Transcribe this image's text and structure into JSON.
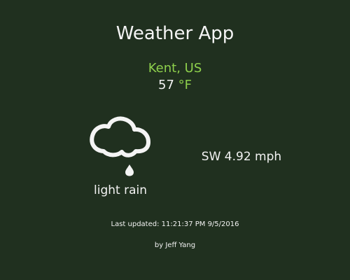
{
  "app": {
    "title": "Weather App"
  },
  "location": {
    "name": "Kent, US"
  },
  "temperature": {
    "value": "57",
    "unit": "°F"
  },
  "conditions": {
    "icon": "rain-cloud-icon",
    "description": "light rain"
  },
  "wind": {
    "text": "SW 4.92 mph"
  },
  "footer": {
    "last_updated": "Last updated: 11:21:37 PM 9/5/2016",
    "author": "by Jeff Yang"
  },
  "colors": {
    "background": "#20301f",
    "accent": "#8ed04c",
    "text": "#f2f2f2"
  }
}
